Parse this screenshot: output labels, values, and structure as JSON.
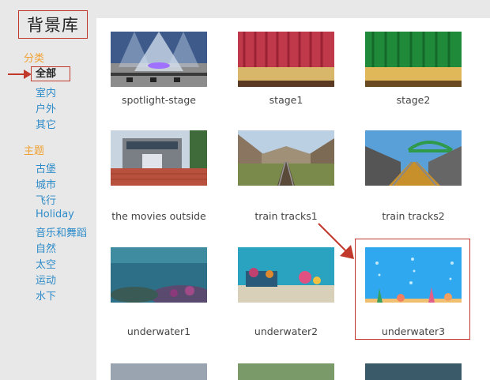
{
  "title": "背景库",
  "categories": {
    "heading": "分类",
    "items": [
      "全部",
      "室内",
      "户外",
      "其它"
    ],
    "selected": "全部"
  },
  "themes": {
    "heading": "主题",
    "items": [
      "古堡",
      "城市",
      "飞行",
      "Holiday",
      "音乐和舞蹈",
      "自然",
      "太空",
      "运动",
      "水下"
    ]
  },
  "backgrounds": [
    {
      "name": "spotlight-stage",
      "icon": "spotlight-stage-thumbnail"
    },
    {
      "name": "stage1",
      "icon": "red-curtain-stage-thumbnail"
    },
    {
      "name": "stage2",
      "icon": "green-curtain-stage-thumbnail"
    },
    {
      "name": "the movies outside",
      "icon": "cinema-building-thumbnail"
    },
    {
      "name": "train tracks1",
      "icon": "canyon-railway-thumbnail"
    },
    {
      "name": "train tracks2",
      "icon": "bridge-railway-thumbnail"
    },
    {
      "name": "underwater1",
      "icon": "dark-reef-thumbnail"
    },
    {
      "name": "underwater2",
      "icon": "coral-reef-thumbnail"
    },
    {
      "name": "underwater3",
      "icon": "cartoon-underwater-thumbnail"
    }
  ],
  "highlighted": "underwater3",
  "colors": {
    "category_heading": "#f0a030",
    "link": "#2e8bc9",
    "annotation": "#c0392b"
  }
}
